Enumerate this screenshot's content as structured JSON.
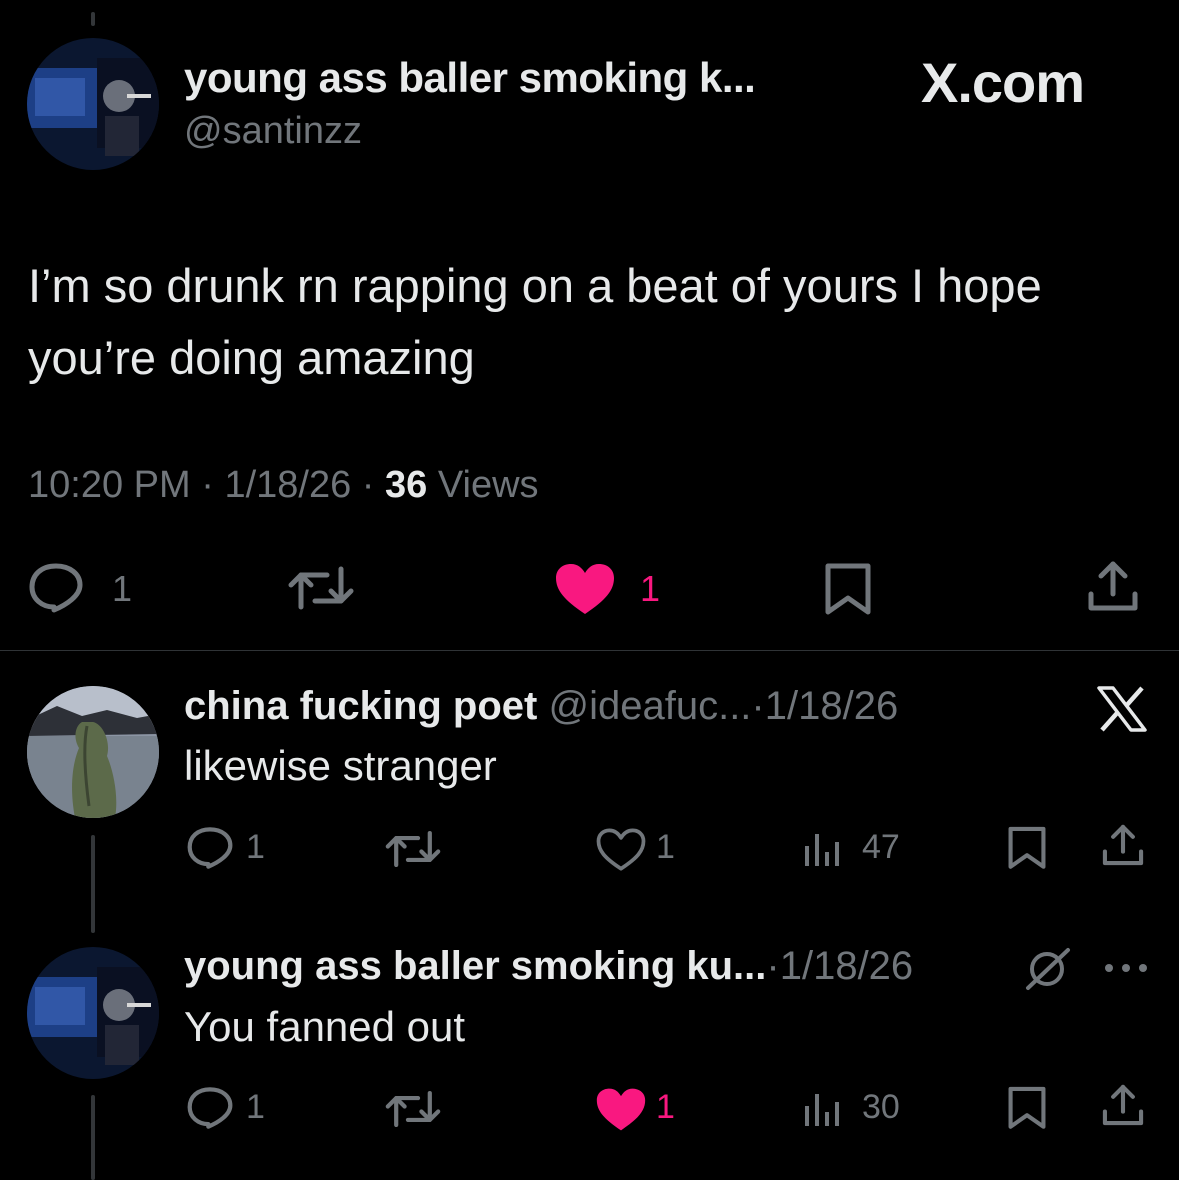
{
  "main_tweet": {
    "display_name": "young ass baller smoking k...",
    "handle": "@santinzz",
    "brand_label": "X.com",
    "text_line1": "I’m so drunk rn rapping on a beat of yours I hope",
    "text_line2": "you’re doing amazing",
    "time": "10:20 PM",
    "sep1": "·",
    "date": "1/18/26",
    "sep2": "·",
    "views_count": "36",
    "views_label": "Views",
    "reply_count": "1",
    "like_count": "1",
    "liked": true
  },
  "reply1": {
    "display_name": "china fucking poet",
    "handle": "@ideafuc...",
    "sep": "·",
    "date": "1/18/26",
    "text": "likewise stranger",
    "reply_count": "1",
    "like_count": "1",
    "views_count": "47",
    "liked": false
  },
  "reply2": {
    "display_name": "young ass baller smoking ku...",
    "sep": "·",
    "date": "1/18/26",
    "text": "You fanned out",
    "reply_count": "1",
    "like_count": "1",
    "views_count": "30",
    "liked": true
  },
  "colors": {
    "background": "#000000",
    "text": "#e7e9ea",
    "muted": "#71767b",
    "like": "#f91880",
    "divider": "#2f3336"
  }
}
